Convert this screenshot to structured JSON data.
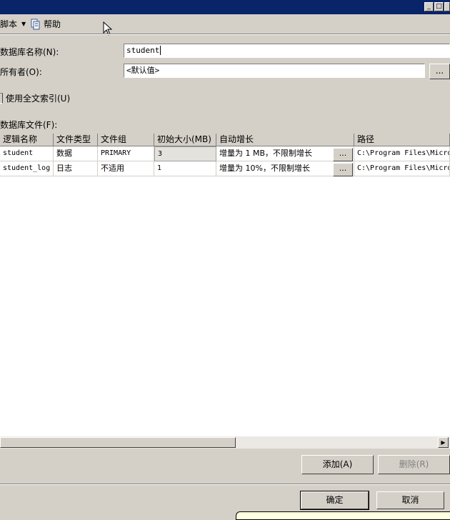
{
  "toolbar": {
    "script_label": "脚本",
    "help_label": "帮助"
  },
  "form": {
    "dbname_label": "数据库名称(N):",
    "dbname_value": "student",
    "owner_label": "所有者(O):",
    "owner_value": "<默认值>",
    "owner_browse_label": "...",
    "fulltext_label": "使用全文索引(U)",
    "files_label": "数据库文件(F):"
  },
  "grid": {
    "columns": [
      "逻辑名称",
      "文件类型",
      "文件组",
      "初始大小(MB)",
      "自动增长",
      "路径"
    ],
    "rows": [
      {
        "name": "student",
        "type": "数据",
        "group": "PRIMARY",
        "size": "3",
        "growth": "增量为 1 MB，不限制增长",
        "path": "C:\\Program Files\\Micro"
      },
      {
        "name": "student_log",
        "type": "日志",
        "group": "不适用",
        "size": "1",
        "growth": "增量为 10%，不限制增长",
        "path": "C:\\Program Files\\Micro"
      }
    ],
    "ellipsis_label": "..."
  },
  "buttons": {
    "add": "添加(A)",
    "remove": "删除(R)",
    "ok": "确定",
    "cancel": "取消"
  },
  "window": {
    "minimize_glyph": "_",
    "maximize_glyph": "□"
  },
  "scrollbar": {
    "right_glyph": "▶"
  }
}
